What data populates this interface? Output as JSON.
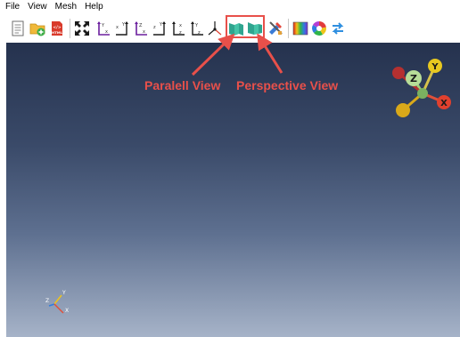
{
  "menu": {
    "items": [
      "File",
      "View",
      "Mesh",
      "Help"
    ]
  },
  "toolbar": {
    "icons": [
      "new-document-icon",
      "open-folder-icon",
      "export-html-icon",
      "fit-view-icon",
      "view-y-up-icon",
      "view-xy-icon",
      "view-z-up-icon",
      "view-zy-icon",
      "view-zx-icon",
      "view-yz-icon",
      "isometric-axes-icon",
      "parallel-view-icon",
      "perspective-view-icon",
      "settings-tools-icon",
      "color-spectrum-icon",
      "color-wheel-icon",
      "swap-icon"
    ]
  },
  "annotations": {
    "parallel_label": "Paralell View",
    "perspective_label": "Perspective View"
  },
  "axes": {
    "x": "X",
    "y": "Y",
    "z": "Z"
  },
  "colors": {
    "accent": "#e8504a",
    "viewport_top": "#25324e",
    "viewport_bottom": "#a6b3c8"
  }
}
